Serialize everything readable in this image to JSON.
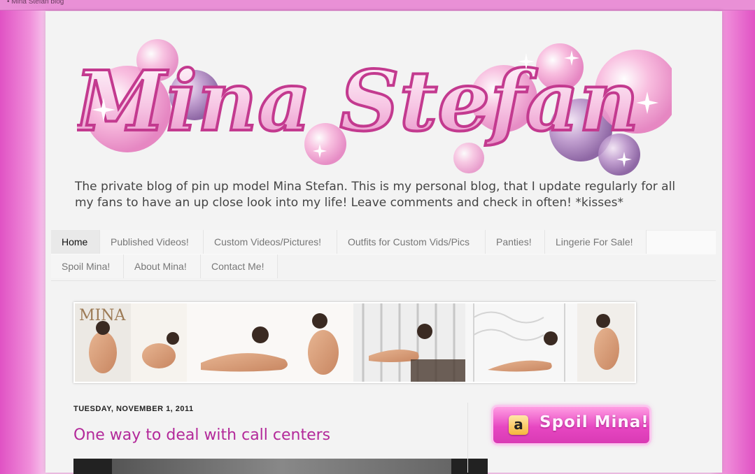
{
  "browser": {
    "status_text": "• Mina Stefan blog"
  },
  "header": {
    "logo_text": "Mina Stefan",
    "description": "The private blog of pin up model Mina Stefan. This is my personal blog, that I update regularly for all my fans to have an up close look into my life! Leave comments and check in often! *kisses*"
  },
  "nav": {
    "tabs": [
      {
        "label": "Home",
        "active": true
      },
      {
        "label": "Published Videos!",
        "active": false
      },
      {
        "label": "Custom Videos/Pictures!",
        "active": false
      },
      {
        "label": "Outfits for Custom Vids/Pics",
        "active": false
      },
      {
        "label": "Panties!",
        "active": false
      },
      {
        "label": "Lingerie For Sale!",
        "active": false
      },
      {
        "label": "Spoil Mina!",
        "active": false
      },
      {
        "label": "About Mina!",
        "active": false
      },
      {
        "label": "Contact Me!",
        "active": false
      }
    ]
  },
  "banner": {
    "text": "MINA"
  },
  "post": {
    "date": "TUESDAY, NOVEMBER 1, 2011",
    "title": "One way to deal with call centers"
  },
  "sidebar": {
    "spoil_button": {
      "icon_letter": "a",
      "label": "Spoil Mina!"
    }
  },
  "colors": {
    "accent": "#b3299a",
    "border_pink": "#e052c4",
    "page_bg": "#f3f3f3"
  }
}
